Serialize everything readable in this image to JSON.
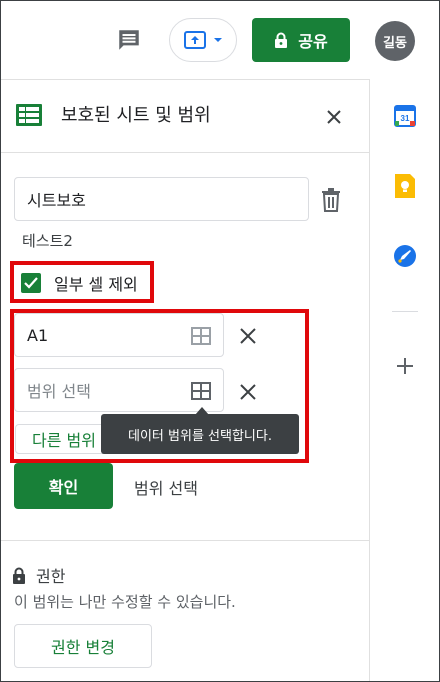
{
  "topbar": {
    "share_label": "공유",
    "avatar_initials": "길동",
    "share_color": "#188038"
  },
  "panel": {
    "title": "보호된 시트 및 범위",
    "description_value": "시트보호",
    "sheet_name": "테스트2",
    "except_cells_label": "일부 셀 제외",
    "except_cells_checked": true,
    "ranges": [
      {
        "value": "A1",
        "placeholder": ""
      },
      {
        "value": "",
        "placeholder": "범위 선택"
      }
    ],
    "other_range_label": "다른 범위",
    "tooltip": "데이터 범위를 선택합니다.",
    "confirm_label": "확인",
    "select_range_label": "범위 선택",
    "permission_title": "권한",
    "permission_desc": "이 범위는 나만 수정할 수 있습니다.",
    "permission_button": "권한 변경"
  },
  "colors": {
    "accent": "#188038",
    "highlight": "#e0080b",
    "tooltip_bg": "#3c4043"
  },
  "icons": [
    "comment-icon",
    "present-icon",
    "lock-icon",
    "sheets-icon",
    "close-icon",
    "trash-icon",
    "check-icon",
    "grid-select-icon",
    "calendar-icon",
    "keep-icon",
    "tasks-icon",
    "plus-icon"
  ]
}
